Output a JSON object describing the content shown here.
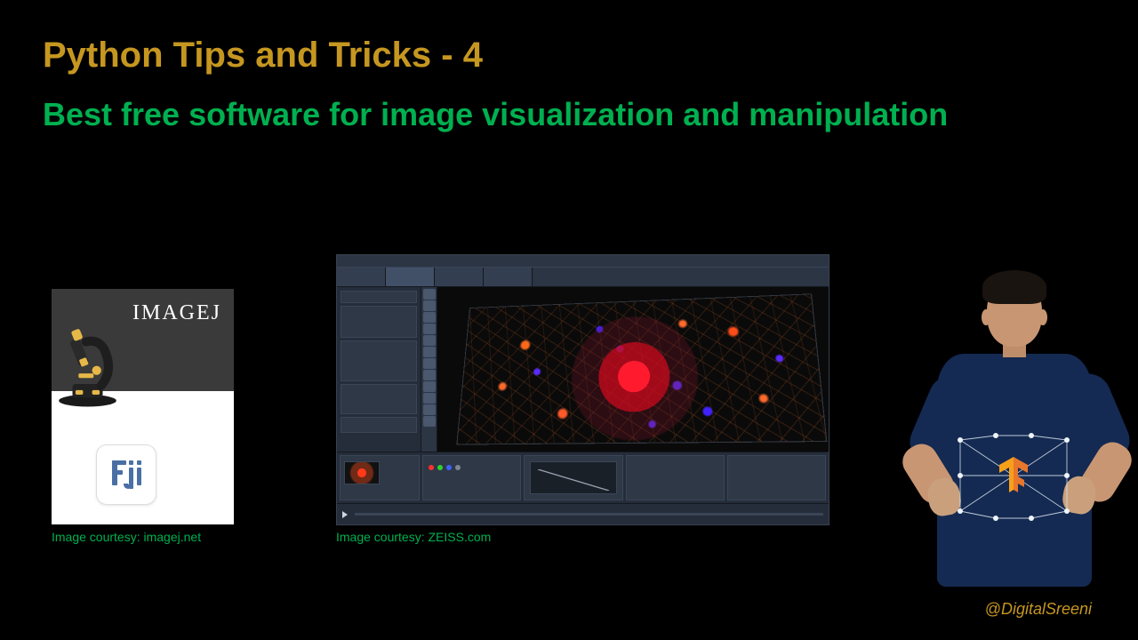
{
  "header": {
    "title": "Python Tips and Tricks - 4",
    "subtitle": "Best free software for image visualization and manipulation"
  },
  "imagej": {
    "logo_text": "IMAGEJ",
    "caption": "Image courtesy: imagej.net"
  },
  "zeiss": {
    "caption": "Image courtesy: ZEISS.com"
  },
  "footer": {
    "handle": "@DigitalSreeni"
  }
}
